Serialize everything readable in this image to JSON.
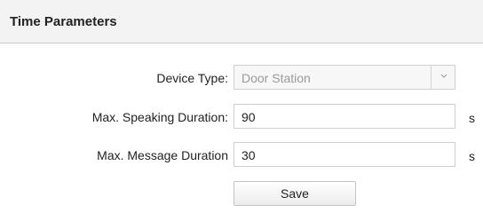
{
  "section": {
    "title": "Time Parameters"
  },
  "form": {
    "device_type": {
      "label": "Device Type:",
      "value": "Door Station",
      "icon": "chevron-down-icon"
    },
    "max_speaking_duration": {
      "label": "Max. Speaking Duration:",
      "value": "90",
      "unit": "s"
    },
    "max_message_duration": {
      "label": "Max. Message Duration",
      "value": "30",
      "unit": "s"
    }
  },
  "actions": {
    "save_label": "Save"
  },
  "colors": {
    "header_background": "#f3f3f3",
    "field_border": "#cfcfcf",
    "disabled_text": "#9a9a9a"
  }
}
